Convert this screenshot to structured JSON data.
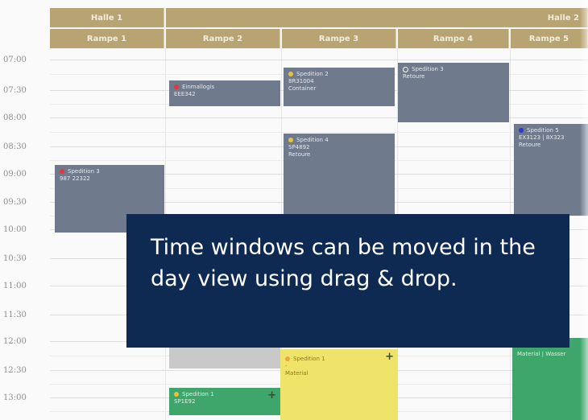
{
  "halls": [
    "Halle 1",
    "Halle 2"
  ],
  "ramps": [
    "Rampe 1",
    "Rampe 2",
    "Rampe 3",
    "Rampe 4",
    "Rampe 5"
  ],
  "times": [
    "07:00",
    "07:30",
    "08:00",
    "08:30",
    "09:00",
    "09:30",
    "10:00",
    "10:30",
    "11:00",
    "11:30",
    "12:00",
    "12:30",
    "13:00"
  ],
  "slots": {
    "s1": {
      "title": "Spedition 3",
      "line2": "987 22322",
      "line3": "",
      "status_color": "#e23a3a"
    },
    "s2": {
      "title": "Einmallogis",
      "line2": "EEE342",
      "line3": "",
      "status_color": "#e23a3a"
    },
    "s3": {
      "title": "Spedition 2",
      "line2": "8R31004",
      "line3": "Container",
      "status_color": "#e8c23a"
    },
    "s4": {
      "title": "Spedition 4",
      "line2": "SP4892",
      "line3": "Retoure",
      "status_color": "#e8c23a"
    },
    "s5": {
      "title": "Spedition 3",
      "line2": "Retoure",
      "line3": "",
      "status_color": "#ffffff"
    },
    "s6": {
      "title": "Spedition 5",
      "line2": "EX3123 | 8X323",
      "line3": "Retoure",
      "status_color": "#2a3acc"
    },
    "s7": {
      "title": "Spedition 1",
      "line2": "-",
      "line3": "Material",
      "status_color": "#e8a83a"
    },
    "s8": {
      "title": "Spedition 1",
      "line2": "SP1E92",
      "line3": "",
      "status_color": "#e8c23a"
    },
    "s9": {
      "title": "Material | Wasser",
      "line2": "",
      "line3": "",
      "status_color": "#3ea66a"
    }
  },
  "caption": "Time windows can be moved in the day view using drag & drop.",
  "colors": {
    "header": "#b8a472",
    "slot_grey": "#6f7a8c",
    "slot_yellow": "#efe36a",
    "slot_green": "#3ea66a",
    "caption_bg": "#0e2a52"
  }
}
